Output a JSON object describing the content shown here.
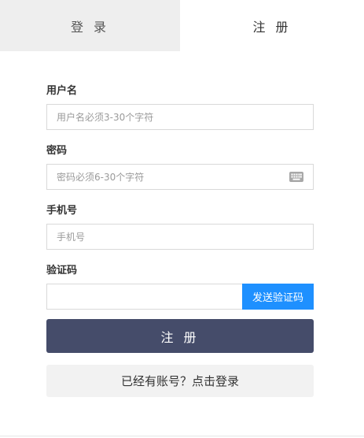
{
  "tabs": {
    "login_label": "登 录",
    "register_label": "注 册",
    "active": "register"
  },
  "form": {
    "username": {
      "label": "用户名",
      "placeholder": "用户名必须3-30个字符",
      "value": ""
    },
    "password": {
      "label": "密码",
      "placeholder": "密码必须6-30个字符",
      "value": "",
      "icon": "keyboard-icon"
    },
    "phone": {
      "label": "手机号",
      "placeholder": "手机号",
      "value": ""
    },
    "code": {
      "label": "验证码",
      "placeholder": "",
      "value": "",
      "send_label": "发送验证码"
    }
  },
  "actions": {
    "register_label": "注 册",
    "login_link_label": "已经有账号？点击登录"
  },
  "colors": {
    "primary_button": "#454c6a",
    "send_code_button": "#1e90ff",
    "inactive_tab": "#eeeeee"
  }
}
